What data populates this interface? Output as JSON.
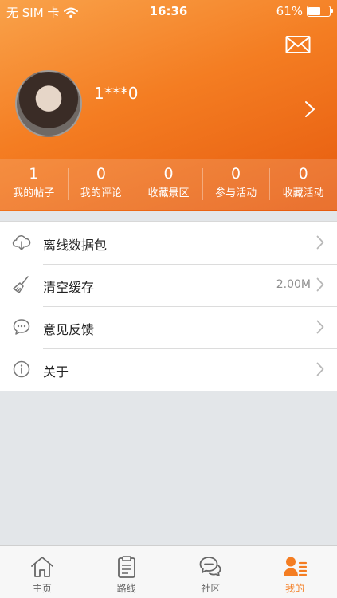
{
  "status_bar": {
    "carrier": "无 SIM 卡",
    "time": "16:36",
    "battery_text": "61%",
    "battery_level": 0.61
  },
  "profile": {
    "username": "1***0"
  },
  "stats": [
    {
      "count": "1",
      "label": "我的帖子"
    },
    {
      "count": "0",
      "label": "我的评论"
    },
    {
      "count": "0",
      "label": "收藏景区"
    },
    {
      "count": "0",
      "label": "参与活动"
    },
    {
      "count": "0",
      "label": "收藏活动"
    }
  ],
  "menu": [
    {
      "label": "离线数据包",
      "value": "",
      "icon": "cloud-download-icon"
    },
    {
      "label": "清空缓存",
      "value": "2.00M",
      "icon": "broom-icon"
    },
    {
      "label": "意见反馈",
      "value": "",
      "icon": "chat-bubble-icon"
    },
    {
      "label": "关于",
      "value": "",
      "icon": "info-icon"
    }
  ],
  "tabs": [
    {
      "label": "主页",
      "icon": "home-icon",
      "active": false
    },
    {
      "label": "路线",
      "icon": "clipboard-icon",
      "active": false
    },
    {
      "label": "社区",
      "icon": "chat-bubbles-icon",
      "active": false
    },
    {
      "label": "我的",
      "icon": "user-icon",
      "active": true
    }
  ],
  "colors": {
    "accent": "#f47d22",
    "header_gradient_start": "#f9a24a",
    "header_gradient_end": "#e65a0e",
    "background": "#e3e6e9"
  }
}
